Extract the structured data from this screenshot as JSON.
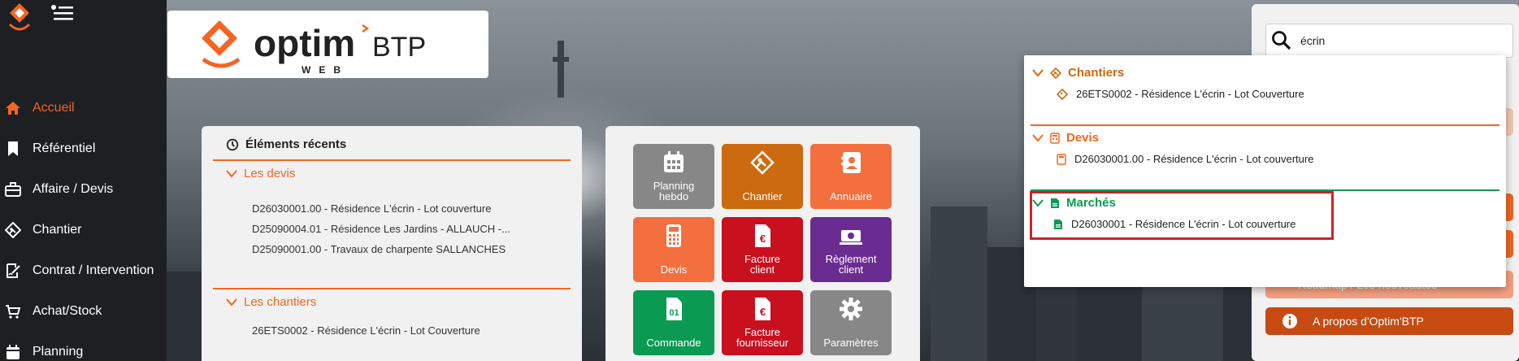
{
  "colors": {
    "accent": "#f26522",
    "sidebar_bg": "#1e1f22",
    "tile_gray": "#878787",
    "tile_orange_dark": "#cc6a10",
    "tile_orange": "#f36f3d",
    "tile_red": "#c8101e",
    "tile_purple": "#6b2c91",
    "tile_green": "#0a9a52",
    "marches_green": "#0a9a52",
    "highlight": "#d0202c"
  },
  "brand": {
    "name": "optim",
    "suffix": "BTP",
    "sub": "WEB"
  },
  "sidebar": {
    "items": [
      {
        "label": "Accueil",
        "icon": "home-icon",
        "active": true
      },
      {
        "label": "Référentiel",
        "icon": "bookmark-icon",
        "active": false
      },
      {
        "label": "Affaire / Devis",
        "icon": "briefcase-icon",
        "active": false
      },
      {
        "label": "Chantier",
        "icon": "worksite-icon",
        "active": false
      },
      {
        "label": "Contrat / Intervention",
        "icon": "contract-icon",
        "active": false
      },
      {
        "label": "Achat/Stock",
        "icon": "cart-icon",
        "active": false
      },
      {
        "label": "Planning",
        "icon": "calendar-icon",
        "active": false
      }
    ]
  },
  "recent": {
    "title": "Éléments récents",
    "devis_title": "Les devis",
    "devis": [
      "D26030001.00 - Résidence L'écrin - Lot couverture",
      "D25090004.01 - Résidence Les Jardins - ALLAUCH -...",
      "D25090001.00 - Travaux de charpente SALLANCHES"
    ],
    "chantiers_title": "Les chantiers",
    "chantiers": [
      "26ETS0002 - Résidence L'écrin - Lot Couverture"
    ]
  },
  "tiles": [
    {
      "label": "Planning hebdo",
      "icon": "calendar-icon",
      "color": "#878787"
    },
    {
      "label": "Chantier",
      "icon": "worksite-icon",
      "color": "#cc6a10"
    },
    {
      "label": "Annuaire",
      "icon": "contacts-icon",
      "color": "#f36f3d"
    },
    {
      "label": "Devis",
      "icon": "calculator-icon",
      "color": "#f36f3d"
    },
    {
      "label": "Facture client",
      "icon": "invoice-euro-icon",
      "color": "#c8101e"
    },
    {
      "label": "Règlement client",
      "icon": "payment-icon",
      "color": "#6b2c91"
    },
    {
      "label": "Commande",
      "icon": "order-icon",
      "color": "#0a9a52"
    },
    {
      "label": "Facture fournisseur",
      "icon": "invoice-euro-icon",
      "color": "#c8101e"
    },
    {
      "label": "Paramètres",
      "icon": "gear-icon",
      "color": "#878787"
    }
  ],
  "search": {
    "value": "écrin"
  },
  "right_buttons": {
    "nouveautes": "Roadmap / Les nouveautés",
    "apropos": "A propos d'Optim'BTP"
  },
  "results": {
    "chantiers_title": "Chantiers",
    "chantiers": [
      "26ETS0002 - Résidence L'écrin - Lot Couverture"
    ],
    "devis_title": "Devis",
    "devis": [
      "D26030001.00 - Résidence L'écrin - Lot couverture"
    ],
    "marches_title": "Marchés",
    "marches": [
      "D26030001 - Résidence L'écrin - Lot couverture"
    ]
  }
}
